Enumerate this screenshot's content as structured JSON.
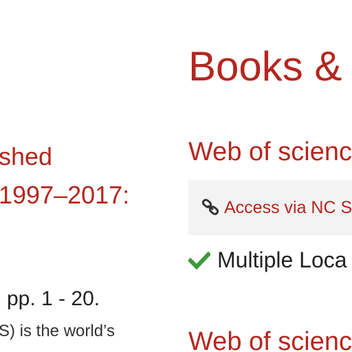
{
  "left_column": {
    "title_line1": "shed",
    "title_line2": "1997–2017:",
    "pages": "pp. 1 - 20.",
    "abstract_snippet": "S) is the world’s"
  },
  "right_column": {
    "section_heading": "Books &",
    "results": [
      {
        "title": "Web of scienc",
        "access_link": "Access via NC S",
        "availability": "Multiple Loca"
      },
      {
        "title": "Web of scienc"
      }
    ]
  },
  "colors": {
    "accent": "#b5261e",
    "check": "#3a9a3a",
    "access_box_bg": "#f3f3f3"
  },
  "icons": {
    "link": "link-icon",
    "check": "check-icon"
  }
}
